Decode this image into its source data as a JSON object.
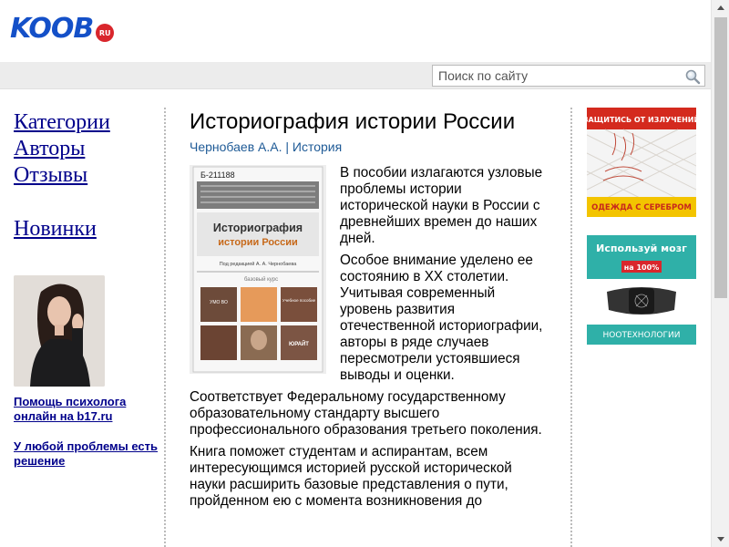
{
  "header": {
    "logo_text": "KOOB",
    "logo_badge": "RU"
  },
  "search": {
    "placeholder": "Поиск по сайту",
    "icon": "magnifier-icon"
  },
  "nav": {
    "items": [
      {
        "label": "Категории"
      },
      {
        "label": "Авторы"
      },
      {
        "label": "Отзывы"
      },
      {
        "label": "Новинки"
      }
    ]
  },
  "promo": {
    "link1": "Помощь психолога онлайн на b17.ru",
    "link2": "У любой проблемы есть решение"
  },
  "book": {
    "title": "Историография истории России",
    "author": "Чернобаев А.А.",
    "separator": "|",
    "category": "История",
    "cover": {
      "code": "Б-211188",
      "title_line1": "Историография",
      "title_line2": "истории России",
      "editor": "Под редакцией А. А. Чернобаева",
      "series": "базовый курс",
      "badge1": "УМО ВО",
      "badge2": "Учебное пособие",
      "publisher": "ЮРАЙТ"
    },
    "paragraphs": [
      "В пособии излагаются узловые проблемы истории исторической науки в России с древнейших времен до наших дней.",
      "Особое внимание уделено ее состоянию в XX столетии. Учитывая современный уровень развития отечественной историографии, авторы в ряде случаев пересмотрели устоявшиеся выводы и оценки.",
      "Соответствует Федеральному государственному образовательному стандарту высшего профессионального образования третьего поколения.",
      "Книга поможет студентам и аспирантам, всем интересующимся историей русской исторической науки расширить базовые представления о пути, пройденном ею с момента возникновения до"
    ]
  },
  "ads": {
    "ad1": {
      "top": "ЗАЩИТИСЬ ОТ ИЗЛУЧЕНИЙ",
      "bottom": "ОДЕЖДА С СЕРЕБРОМ"
    },
    "ad2": {
      "top": "Используй мозг",
      "badge": "на 100%",
      "bottom": "НООТЕХНОЛОГИИ"
    }
  },
  "colors": {
    "logo_blue": "#1450c8",
    "logo_red": "#d9262c",
    "nav_link": "#00008b",
    "meta_link": "#1e5a96",
    "ad1_red": "#d42a1e",
    "ad1_yellow": "#f3c400",
    "ad2_teal": "#2fb0a8"
  }
}
